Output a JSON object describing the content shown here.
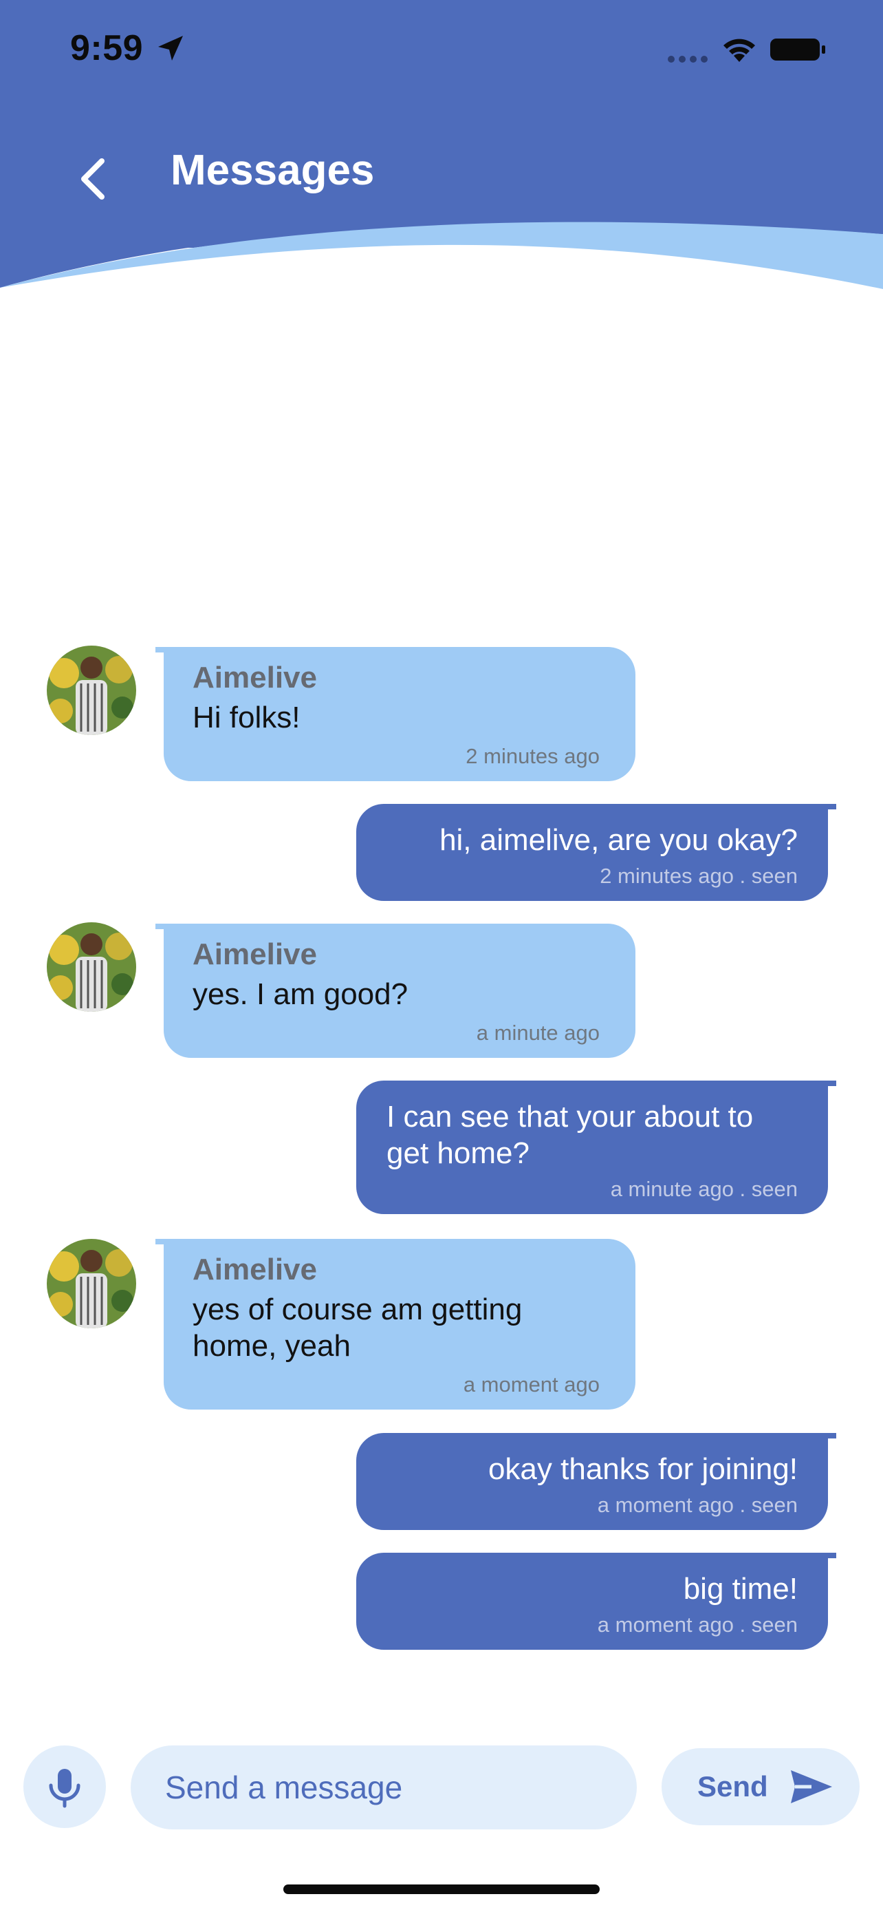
{
  "status_bar": {
    "time": "9:59"
  },
  "header": {
    "title": "Messages"
  },
  "messages": [
    {
      "direction": "in",
      "sender": "Aimelive",
      "text": "Hi folks!",
      "meta": "2 minutes ago"
    },
    {
      "direction": "out",
      "text": "hi, aimelive, are you okay?",
      "meta": "2 minutes ago . seen"
    },
    {
      "direction": "in",
      "sender": "Aimelive",
      "text": "yes. I am good?",
      "meta": "a minute ago"
    },
    {
      "direction": "out",
      "text": "I can see that your about to get home?",
      "meta": "a minute ago . seen"
    },
    {
      "direction": "in",
      "sender": "Aimelive",
      "text": "yes of course am getting home, yeah",
      "meta": "a moment ago"
    },
    {
      "direction": "out",
      "text": "okay thanks for joining!",
      "meta": "a moment ago . seen"
    },
    {
      "direction": "out",
      "text": "big time!",
      "meta": "a moment ago . seen"
    }
  ],
  "composer": {
    "placeholder": "Send a message",
    "send_label": "Send"
  },
  "colors": {
    "header": "#4e6cbb",
    "header_wave": "#9fcbf5",
    "incoming_bubble": "#9fcbf5",
    "outgoing_bubble": "#4e6cbb",
    "composer_bg": "#e2eefb"
  },
  "icons": [
    "location-arrow-icon",
    "signal-dots-icon",
    "wifi-icon",
    "battery-icon",
    "back-chevron-icon",
    "microphone-icon",
    "send-icon"
  ]
}
